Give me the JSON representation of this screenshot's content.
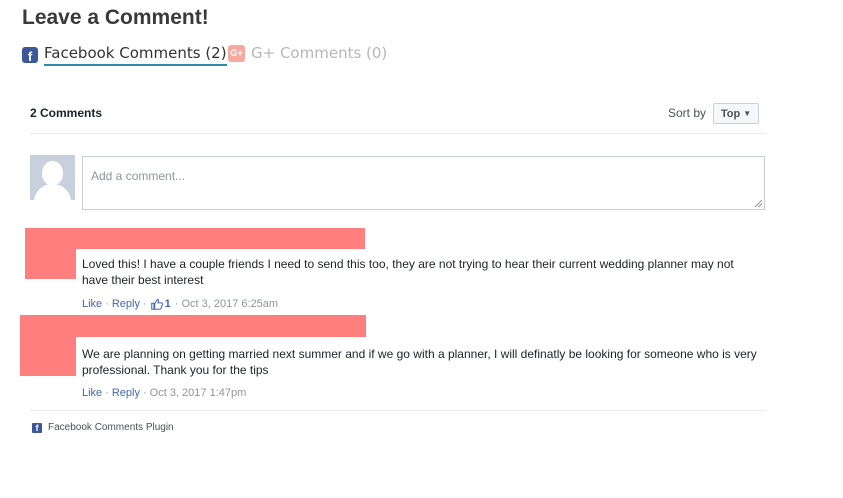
{
  "heading": "Leave a Comment!",
  "tabs": {
    "facebook": {
      "icon": "f",
      "label": "Facebook Comments (2)"
    },
    "gplus": {
      "icon": "G+",
      "label": "G+ Comments (0)"
    }
  },
  "comments_header": {
    "count_label": "2 Comments",
    "sort_label": "Sort by",
    "sort_value": "Top",
    "sort_caret": "▼"
  },
  "composer": {
    "placeholder": "Add a comment..."
  },
  "comments": [
    {
      "text": "Loved this! I have a couple friends I need to send this too, they are not trying to hear their current wedding planner may not have their best interest",
      "like_label": "Like",
      "reply_label": "Reply",
      "separator": "·",
      "likes": "1",
      "timestamp": "Oct 3, 2017 6:25am"
    },
    {
      "text": "We are planning on getting married next summer and if we go with a planner, I will definatly be looking for someone who is very professional. Thank you for the tips",
      "like_label": "Like",
      "reply_label": "Reply",
      "separator": "·",
      "timestamp": "Oct 3, 2017 1:47pm"
    }
  ],
  "footer": {
    "icon": "f",
    "label": "Facebook Comments Plugin"
  },
  "colors": {
    "facebook_blue": "#3b5998",
    "link_blue": "#4267b2",
    "tab_underline": "#2f8aa3",
    "redaction": "#ff7f7f",
    "gplus_faded": "#f5a9a0"
  }
}
